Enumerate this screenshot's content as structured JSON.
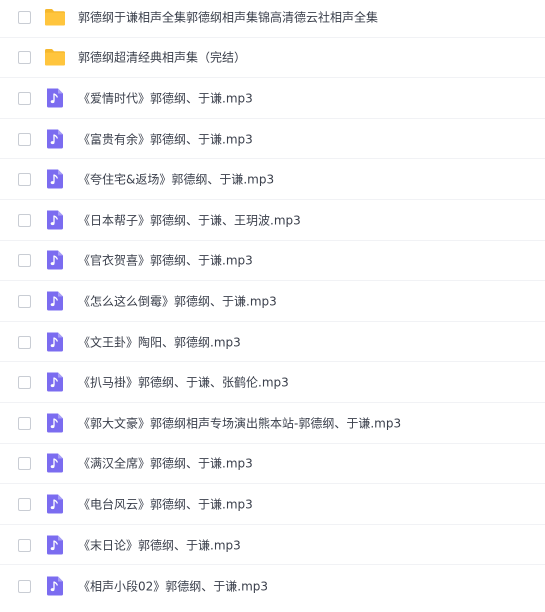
{
  "files": [
    {
      "name": "郭德纲于谦相声全集郭德纲相声集锦高清德云社相声全集",
      "type": "folder",
      "icon": "folder-icon"
    },
    {
      "name": "郭德纲超清经典相声集（完结）",
      "type": "folder",
      "icon": "folder-icon"
    },
    {
      "name": "《爱情时代》郭德纲、于谦.mp3",
      "type": "audio",
      "icon": "music-note-icon"
    },
    {
      "name": "《富贵有余》郭德纲、于谦.mp3",
      "type": "audio",
      "icon": "music-note-icon"
    },
    {
      "name": "《夸住宅&返场》郭德纲、于谦.mp3",
      "type": "audio",
      "icon": "music-note-icon"
    },
    {
      "name": "《日本帮子》郭德纲、于谦、王玥波.mp3",
      "type": "audio",
      "icon": "music-note-icon"
    },
    {
      "name": "《官衣贺喜》郭德纲、于谦.mp3",
      "type": "audio",
      "icon": "music-note-icon"
    },
    {
      "name": "《怎么这么倒霉》郭德纲、于谦.mp3",
      "type": "audio",
      "icon": "music-note-icon"
    },
    {
      "name": "《文王卦》陶阳、郭德纲.mp3",
      "type": "audio",
      "icon": "music-note-icon"
    },
    {
      "name": "《扒马褂》郭德纲、于谦、张鹤伦.mp3",
      "type": "audio",
      "icon": "music-note-icon"
    },
    {
      "name": "《郭大文豪》郭德纲相声专场演出熊本站-郭德纲、于谦.mp3",
      "type": "audio",
      "icon": "music-note-icon"
    },
    {
      "name": "《满汉全席》郭德纲、于谦.mp3",
      "type": "audio",
      "icon": "music-note-icon"
    },
    {
      "name": "《电台风云》郭德纲、于谦.mp3",
      "type": "audio",
      "icon": "music-note-icon"
    },
    {
      "name": "《末日论》郭德纲、于谦.mp3",
      "type": "audio",
      "icon": "music-note-icon"
    },
    {
      "name": "《相声小段02》郭德纲、于谦.mp3",
      "type": "audio",
      "icon": "music-note-icon"
    }
  ],
  "colors": {
    "folder": "#ffc53d",
    "folder_back": "#f5b82e",
    "audio": "#7b6cf0",
    "text": "#3a3f4b",
    "row_border": "#f1f2f5",
    "checkbox_border": "#c9cdd4"
  }
}
